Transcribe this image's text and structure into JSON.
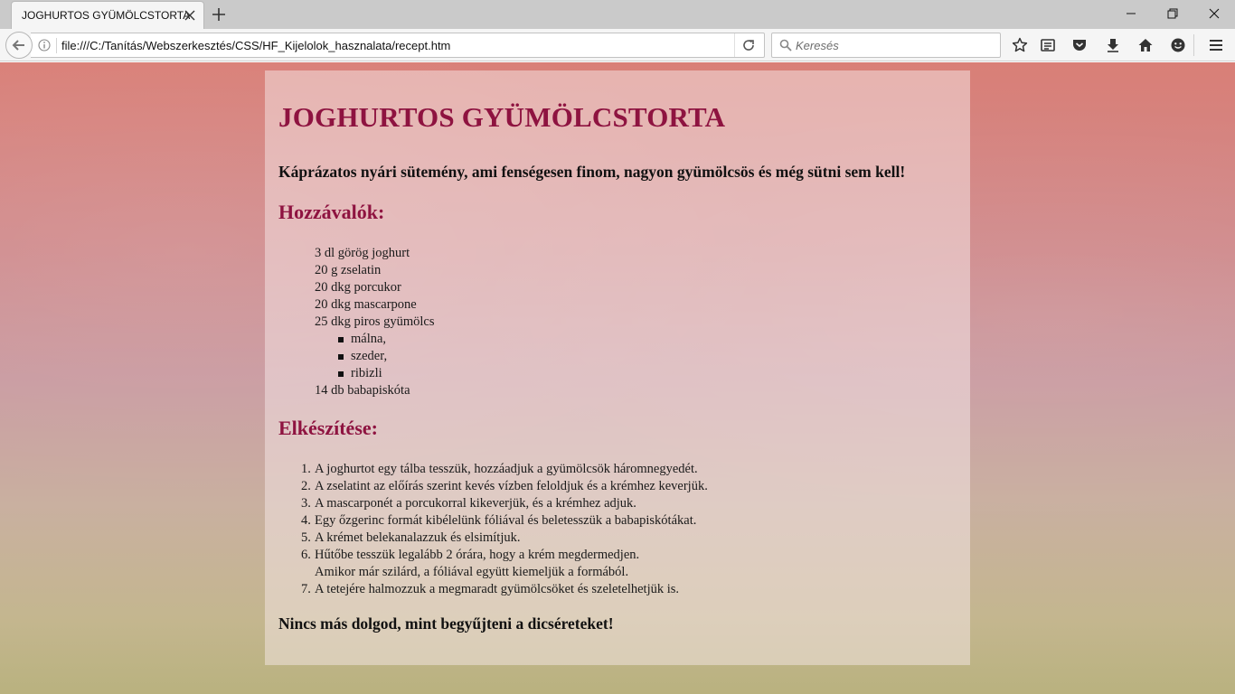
{
  "browser": {
    "tab_title": "JOGHURTOS GYÜMÖLCSTORTA",
    "url": "file:///C:/Tanítás/Webszerkesztés/CSS/HF_Kijelolok_hasznalata/recept.htm",
    "search_placeholder": "Keresés"
  },
  "page": {
    "title": "JOGHURTOS GYÜMÖLCSTORTA",
    "intro": "Káprázatos nyári sütemény, ami fenségesen finom, nagyon gyümölcsös és még sütni sem kell!",
    "ingredients_heading": "Hozzávalók:",
    "ingredients": [
      "3 dl görög joghurt",
      "20 g zselatin",
      "20 dkg porcukor",
      "20 dkg mascarpone",
      "25 dkg piros gyümölcs",
      "14 db babapiskóta"
    ],
    "fruits": [
      "málna,",
      "szeder,",
      "ribizli"
    ],
    "preparation_heading": "Elkészítése:",
    "steps": [
      "A joghurtot egy tálba tesszük, hozzáadjuk a gyümölcsök háromnegyedét.",
      "A zselatint az előírás szerint kevés vízben feloldjuk és a krémhez keverjük.",
      "A mascarponét a porcukorral kikeverjük, és a krémhez adjuk.",
      "Egy őzgerinc formát kibélelünk fóliával és beletesszük a babapiskótákat.",
      "A krémet belekanalazzuk és elsimítjuk.",
      "Hűtőbe tesszük legalább 2 órára, hogy a krém megdermedjen.",
      "A tetejére halmozzuk a megmaradt gyümölcsöket és szeletelhetjük is."
    ],
    "step6_extra": "Amikor már szilárd, a fóliával együtt kiemeljük a formából.",
    "step_numbers": [
      "1.",
      "2.",
      "3.",
      "4.",
      "5.",
      "6.",
      "7."
    ],
    "outro": "Nincs más dolgod, mint begyűjteni a dicséreteket!"
  }
}
